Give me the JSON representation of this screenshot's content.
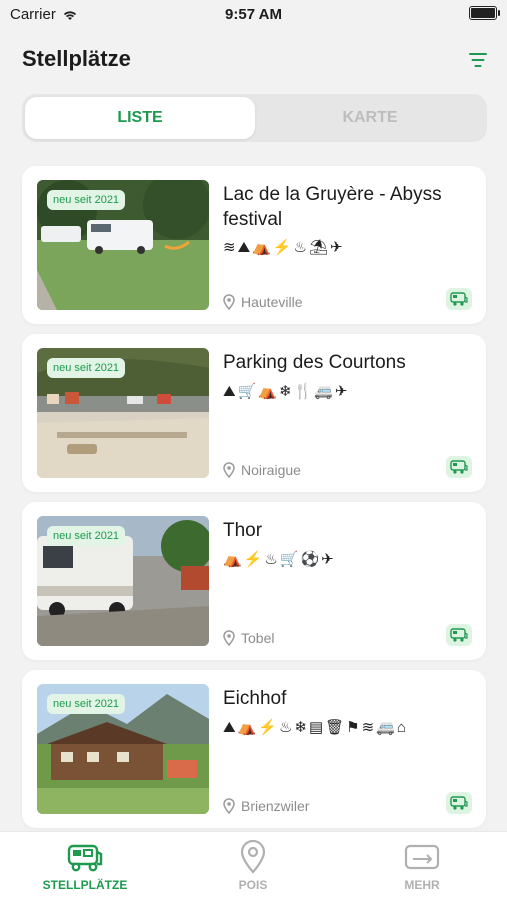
{
  "status": {
    "carrier": "Carrier",
    "time": "9:57 AM",
    "battery_level": 0.92
  },
  "header": {
    "title": "Stellplätze"
  },
  "segment": {
    "active": "LISTE",
    "inactive": "KARTE"
  },
  "badge_text": "neu seit 2021",
  "cards": [
    {
      "title": "Lac de la Gruyère - Abyss festival",
      "icons": "≋⛰⛺⚡♨⛱✈",
      "location": "Hauteville"
    },
    {
      "title": "Parking des Courtons",
      "icons": "⛰🛒⛺❄🍴🚐✈",
      "location": "Noiraigue"
    },
    {
      "title": "Thor",
      "icons": "⛺⚡♨🛒⚽✈",
      "location": "Tobel"
    },
    {
      "title": "Eichhof",
      "icons": "⛰⛺⚡♨❄▤🗑⚑≋🚐⌂",
      "location": "Brienzwiler"
    }
  ],
  "tabbar": {
    "items": [
      {
        "label": "STELLPLÄTZE"
      },
      {
        "label": "POIS"
      },
      {
        "label": "MEHR"
      }
    ],
    "colors": {
      "active": "#1e9a4f",
      "inactive": "#b0b0b0"
    }
  }
}
